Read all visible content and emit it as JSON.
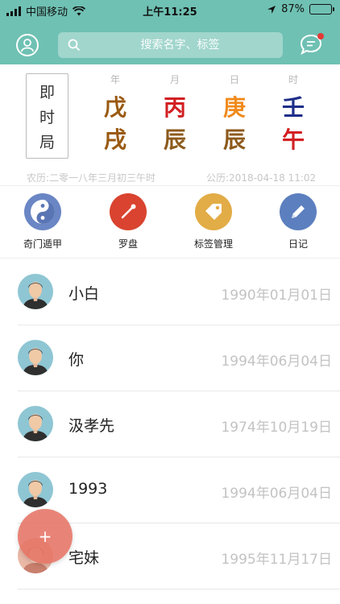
{
  "status_bar": {
    "carrier": "中国移动",
    "time": "上午11:25",
    "battery_pct": "87%",
    "battery_level": 0.87
  },
  "header": {
    "search_placeholder": "搜索名字、标签",
    "icons": [
      "user-icon",
      "search-icon",
      "message-icon"
    ],
    "accent_color": "#6fc1b3",
    "notification_dot_color": "#e53935"
  },
  "bazi": {
    "mode_label": [
      "即",
      "时",
      "局"
    ],
    "pillars": [
      {
        "label": "年",
        "stem": "戊",
        "branch": "戌",
        "stem_color": "#9a5a12",
        "branch_color": "#9a5a12"
      },
      {
        "label": "月",
        "stem": "丙",
        "branch": "辰",
        "stem_color": "#d21f22",
        "branch_color": "#8d5a1b"
      },
      {
        "label": "日",
        "stem": "庚",
        "branch": "辰",
        "stem_color": "#f08a1c",
        "branch_color": "#8d5a1b"
      },
      {
        "label": "时",
        "stem": "壬",
        "branch": "午",
        "stem_color": "#1e2e8a",
        "branch_color": "#d21f22"
      }
    ],
    "lunar_date": "农历:二零一八年三月初三午时",
    "solar_date": "公历:2018-04-18 11:02"
  },
  "tools": [
    {
      "label": "奇门遁甲",
      "icon": "yin-yang-icon",
      "color": "#6a86c4"
    },
    {
      "label": "罗盘",
      "icon": "compass-icon",
      "color": "#d9432f"
    },
    {
      "label": "标签管理",
      "icon": "tag-icon",
      "color": "#e2ac46"
    },
    {
      "label": "日记",
      "icon": "pencil-icon",
      "color": "#5c7fbf"
    }
  ],
  "contacts": [
    {
      "name": "小白",
      "birthday": "1990年01月01日"
    },
    {
      "name": "你",
      "birthday": "1994年06月04日"
    },
    {
      "name": "汲孝先",
      "birthday": "1974年10月19日"
    },
    {
      "name": "1993",
      "birthday": "1994年06月04日"
    },
    {
      "name": "宅妹",
      "birthday": "1995年11月17日"
    }
  ],
  "fab": {
    "label": "+",
    "color": "#e57364"
  }
}
